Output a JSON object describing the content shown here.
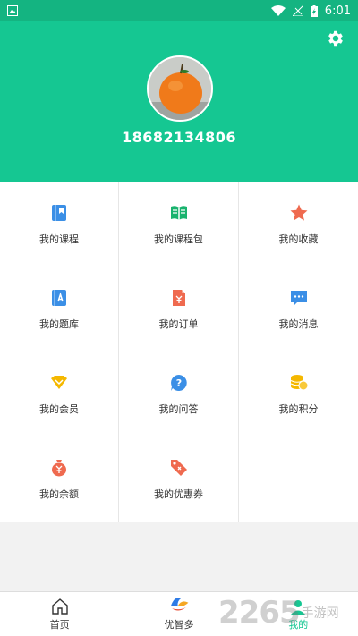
{
  "status_bar": {
    "time": "6:01"
  },
  "profile": {
    "phone": "18682134806"
  },
  "menu": [
    {
      "label": "我的课程",
      "icon": "course-icon",
      "color": "#3b8fe6"
    },
    {
      "label": "我的课程包",
      "icon": "course-package-icon",
      "color": "#19b36e"
    },
    {
      "label": "我的收藏",
      "icon": "star-icon",
      "color": "#ef6a4f"
    },
    {
      "label": "我的题库",
      "icon": "question-bank-icon",
      "color": "#3b8fe6"
    },
    {
      "label": "我的订单",
      "icon": "order-icon",
      "color": "#ef6a4f"
    },
    {
      "label": "我的消息",
      "icon": "message-icon",
      "color": "#3b8fe6"
    },
    {
      "label": "我的会员",
      "icon": "member-icon",
      "color": "#f5b800"
    },
    {
      "label": "我的问答",
      "icon": "qa-icon",
      "color": "#3b8fe6"
    },
    {
      "label": "我的积分",
      "icon": "points-icon",
      "color": "#f5b800"
    },
    {
      "label": "我的余额",
      "icon": "balance-icon",
      "color": "#ef6a4f"
    },
    {
      "label": "我的优惠券",
      "icon": "coupon-icon",
      "color": "#ef6a4f"
    }
  ],
  "bottom_nav": [
    {
      "label": "首页",
      "icon": "home-icon"
    },
    {
      "label": "优智多",
      "icon": "brand-logo-icon"
    },
    {
      "label": "我的",
      "icon": "profile-icon",
      "active": true
    }
  ],
  "watermark": {
    "number": "2265",
    "text": "手游网"
  },
  "colors": {
    "primary": "#15c792",
    "status_bar": "#14b481"
  }
}
